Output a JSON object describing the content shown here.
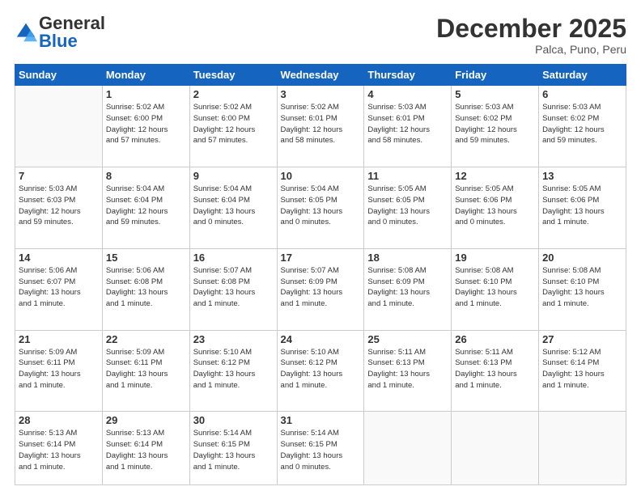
{
  "header": {
    "logo_general": "General",
    "logo_blue": "Blue",
    "month": "December 2025",
    "location": "Palca, Puno, Peru"
  },
  "days_of_week": [
    "Sunday",
    "Monday",
    "Tuesday",
    "Wednesday",
    "Thursday",
    "Friday",
    "Saturday"
  ],
  "weeks": [
    [
      {
        "day": "",
        "info": ""
      },
      {
        "day": "1",
        "info": "Sunrise: 5:02 AM\nSunset: 6:00 PM\nDaylight: 12 hours\nand 57 minutes."
      },
      {
        "day": "2",
        "info": "Sunrise: 5:02 AM\nSunset: 6:00 PM\nDaylight: 12 hours\nand 57 minutes."
      },
      {
        "day": "3",
        "info": "Sunrise: 5:02 AM\nSunset: 6:01 PM\nDaylight: 12 hours\nand 58 minutes."
      },
      {
        "day": "4",
        "info": "Sunrise: 5:03 AM\nSunset: 6:01 PM\nDaylight: 12 hours\nand 58 minutes."
      },
      {
        "day": "5",
        "info": "Sunrise: 5:03 AM\nSunset: 6:02 PM\nDaylight: 12 hours\nand 59 minutes."
      },
      {
        "day": "6",
        "info": "Sunrise: 5:03 AM\nSunset: 6:02 PM\nDaylight: 12 hours\nand 59 minutes."
      }
    ],
    [
      {
        "day": "7",
        "info": "Sunrise: 5:03 AM\nSunset: 6:03 PM\nDaylight: 12 hours\nand 59 minutes."
      },
      {
        "day": "8",
        "info": "Sunrise: 5:04 AM\nSunset: 6:04 PM\nDaylight: 12 hours\nand 59 minutes."
      },
      {
        "day": "9",
        "info": "Sunrise: 5:04 AM\nSunset: 6:04 PM\nDaylight: 13 hours\nand 0 minutes."
      },
      {
        "day": "10",
        "info": "Sunrise: 5:04 AM\nSunset: 6:05 PM\nDaylight: 13 hours\nand 0 minutes."
      },
      {
        "day": "11",
        "info": "Sunrise: 5:05 AM\nSunset: 6:05 PM\nDaylight: 13 hours\nand 0 minutes."
      },
      {
        "day": "12",
        "info": "Sunrise: 5:05 AM\nSunset: 6:06 PM\nDaylight: 13 hours\nand 0 minutes."
      },
      {
        "day": "13",
        "info": "Sunrise: 5:05 AM\nSunset: 6:06 PM\nDaylight: 13 hours\nand 1 minute."
      }
    ],
    [
      {
        "day": "14",
        "info": "Sunrise: 5:06 AM\nSunset: 6:07 PM\nDaylight: 13 hours\nand 1 minute."
      },
      {
        "day": "15",
        "info": "Sunrise: 5:06 AM\nSunset: 6:08 PM\nDaylight: 13 hours\nand 1 minute."
      },
      {
        "day": "16",
        "info": "Sunrise: 5:07 AM\nSunset: 6:08 PM\nDaylight: 13 hours\nand 1 minute."
      },
      {
        "day": "17",
        "info": "Sunrise: 5:07 AM\nSunset: 6:09 PM\nDaylight: 13 hours\nand 1 minute."
      },
      {
        "day": "18",
        "info": "Sunrise: 5:08 AM\nSunset: 6:09 PM\nDaylight: 13 hours\nand 1 minute."
      },
      {
        "day": "19",
        "info": "Sunrise: 5:08 AM\nSunset: 6:10 PM\nDaylight: 13 hours\nand 1 minute."
      },
      {
        "day": "20",
        "info": "Sunrise: 5:08 AM\nSunset: 6:10 PM\nDaylight: 13 hours\nand 1 minute."
      }
    ],
    [
      {
        "day": "21",
        "info": "Sunrise: 5:09 AM\nSunset: 6:11 PM\nDaylight: 13 hours\nand 1 minute."
      },
      {
        "day": "22",
        "info": "Sunrise: 5:09 AM\nSunset: 6:11 PM\nDaylight: 13 hours\nand 1 minute."
      },
      {
        "day": "23",
        "info": "Sunrise: 5:10 AM\nSunset: 6:12 PM\nDaylight: 13 hours\nand 1 minute."
      },
      {
        "day": "24",
        "info": "Sunrise: 5:10 AM\nSunset: 6:12 PM\nDaylight: 13 hours\nand 1 minute."
      },
      {
        "day": "25",
        "info": "Sunrise: 5:11 AM\nSunset: 6:13 PM\nDaylight: 13 hours\nand 1 minute."
      },
      {
        "day": "26",
        "info": "Sunrise: 5:11 AM\nSunset: 6:13 PM\nDaylight: 13 hours\nand 1 minute."
      },
      {
        "day": "27",
        "info": "Sunrise: 5:12 AM\nSunset: 6:14 PM\nDaylight: 13 hours\nand 1 minute."
      }
    ],
    [
      {
        "day": "28",
        "info": "Sunrise: 5:13 AM\nSunset: 6:14 PM\nDaylight: 13 hours\nand 1 minute."
      },
      {
        "day": "29",
        "info": "Sunrise: 5:13 AM\nSunset: 6:14 PM\nDaylight: 13 hours\nand 1 minute."
      },
      {
        "day": "30",
        "info": "Sunrise: 5:14 AM\nSunset: 6:15 PM\nDaylight: 13 hours\nand 1 minute."
      },
      {
        "day": "31",
        "info": "Sunrise: 5:14 AM\nSunset: 6:15 PM\nDaylight: 13 hours\nand 0 minutes."
      },
      {
        "day": "",
        "info": ""
      },
      {
        "day": "",
        "info": ""
      },
      {
        "day": "",
        "info": ""
      }
    ]
  ]
}
